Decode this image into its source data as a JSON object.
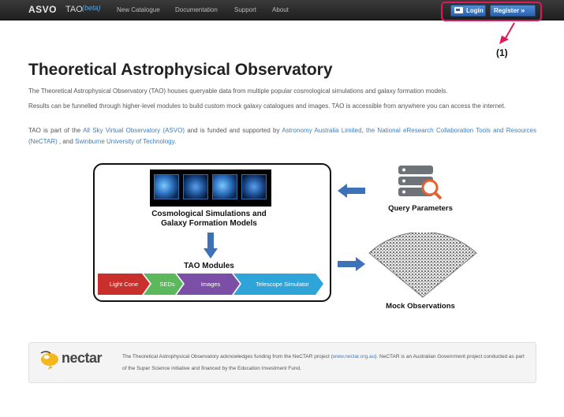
{
  "navbar": {
    "brand": "ASVO",
    "app_name": "TAO",
    "beta": "(beta)",
    "links": [
      "New Catalogue",
      "Documentation",
      "Support",
      "About"
    ],
    "login_label": "Login",
    "register_label": "Register",
    "callout": "(1)"
  },
  "main": {
    "title": "Theoretical Astrophysical Observatory",
    "para1": "The Theoretical Astrophysical Observatory (TAO) houses queryable data from multiple popular cosmological simulations and galaxy formation models.",
    "para2": "Results can be funnelled through higher-level modules to build custom mock galaxy catalogues and images. TAO is accessible from anywhere you can access the internet.",
    "para3": {
      "t1": "TAO is part of the ",
      "link1": "All Sky Virtual Observatory (ASVO)",
      "t2": " and is funded and supported by ",
      "link2": "Astronomy Australia Limited",
      "t3": ", ",
      "link3": "the National eResearch Collaboration Tools and Resources (NeCTAR)",
      "t4": " , and ",
      "link4": "Swinburne University of Technology",
      "t5": "."
    }
  },
  "diagram": {
    "sim_label_1": "Cosmological Simulations and",
    "sim_label_2": "Galaxy Formation Models",
    "modules_label": "TAO Modules",
    "modules": [
      "Light Cone",
      "SEDs",
      "Images",
      "Telescope Simulator"
    ],
    "query_label": "Query Parameters",
    "mock_label": "Mock Observations",
    "colors": {
      "light_cone": "#c9302c",
      "seds": "#5cb85c",
      "images": "#7b4fa6",
      "telescope": "#2fa4d8",
      "arrow": "#3d72b8"
    }
  },
  "footer": {
    "logo_text": "nectar",
    "t1": "The Theoretical Astrophysical Observatory acknowledges funding from the NeCTAR project (",
    "link": "www.nectar.org.au",
    "t2": "). NeCTAR is an Australian Government project conducted as part of the Super Science initiative and financed by the Education Investment Fund."
  }
}
